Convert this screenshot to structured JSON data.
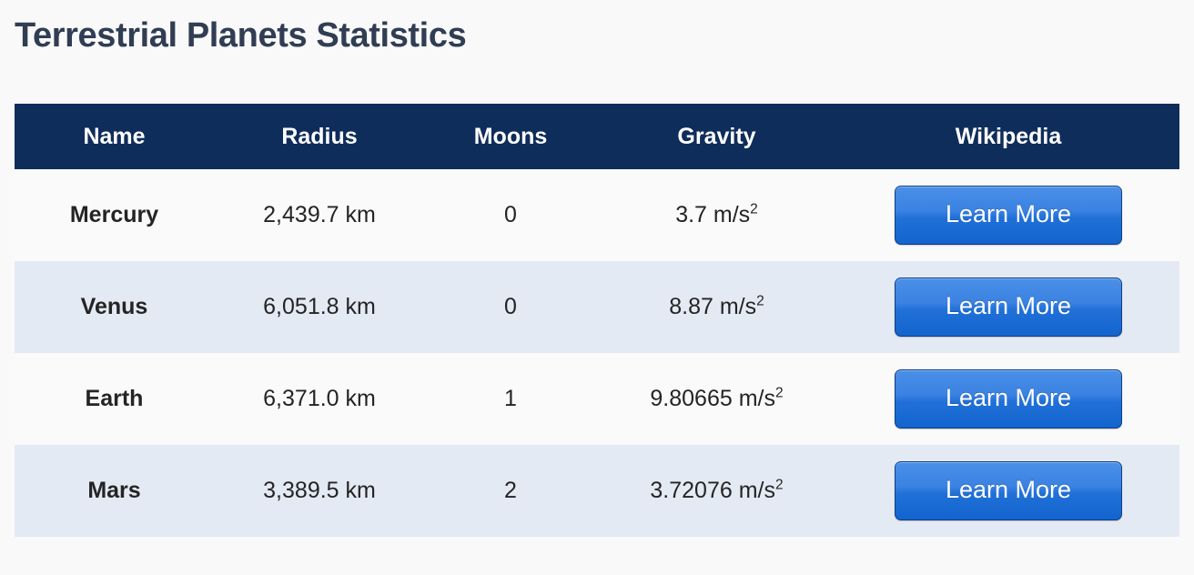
{
  "page": {
    "title": "Terrestrial Planets Statistics",
    "background_color": "#f9f9fa",
    "title_color": "#303d53"
  },
  "table": {
    "header_background": "#0f2d5a",
    "header_text_color": "#ffffff",
    "row_odd_background": "#fafafa",
    "row_even_background": "#e4eaf4",
    "columns": [
      {
        "key": "name",
        "label": "Name"
      },
      {
        "key": "radius",
        "label": "Radius"
      },
      {
        "key": "moons",
        "label": "Moons"
      },
      {
        "key": "gravity",
        "label": "Gravity"
      },
      {
        "key": "wikipedia",
        "label": "Wikipedia"
      }
    ],
    "rows": [
      {
        "name": "Mercury",
        "radius": "2,439.7 km",
        "moons": "0",
        "gravity_value": "3.7 m/s",
        "gravity_exponent": "2",
        "link_label": "Learn More"
      },
      {
        "name": "Venus",
        "radius": "6,051.8 km",
        "moons": "0",
        "gravity_value": "8.87 m/s",
        "gravity_exponent": "2",
        "link_label": "Learn More"
      },
      {
        "name": "Earth",
        "radius": "6,371.0 km",
        "moons": "1",
        "gravity_value": "9.80665 m/s",
        "gravity_exponent": "2",
        "link_label": "Learn More"
      },
      {
        "name": "Mars",
        "radius": "3,389.5 km",
        "moons": "2",
        "gravity_value": "3.72076 m/s",
        "gravity_exponent": "2",
        "link_label": "Learn More"
      }
    ]
  },
  "button_style": {
    "gradient_top": "#4a90e8",
    "gradient_bottom": "#1364cd",
    "border_color": "#0b3f86",
    "text_color": "#ffffff"
  }
}
